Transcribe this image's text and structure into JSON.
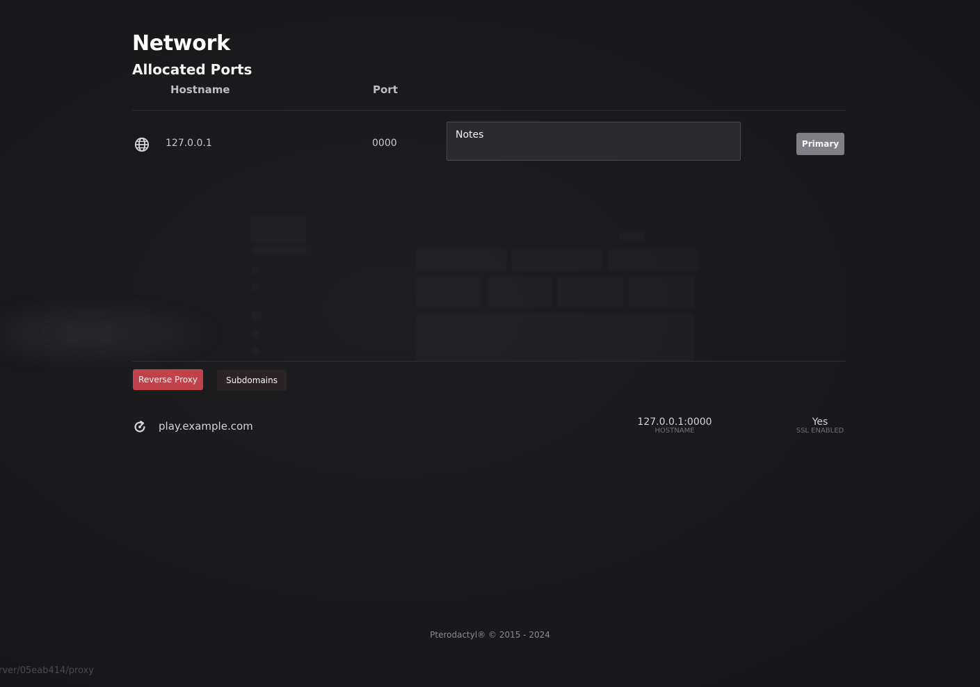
{
  "page": {
    "title": "Network",
    "subtitle": "Allocated Ports"
  },
  "ports_table": {
    "columns": [
      "Hostname",
      "Port"
    ],
    "rows": [
      {
        "icon": "globe-icon",
        "hostname": "127.0.0.1",
        "port": "0000",
        "notes_placeholder": "Notes",
        "primary_label": "Primary"
      }
    ]
  },
  "tabs": {
    "reverse_proxy": "Reverse Proxy",
    "subdomains": "Subdomains",
    "active": "reverse_proxy"
  },
  "proxy": {
    "icon": "refresh-icon",
    "domain": "play.example.com",
    "hostname_value": "127.0.0.1:0000",
    "hostname_label": "HOSTNAME",
    "ssl_value": "Yes",
    "ssl_label": "SSL ENABLED"
  },
  "footer": {
    "text": "Pterodactyl® © 2015 - 2024"
  },
  "status_bar": {
    "url": "rver/05eab414/proxy"
  },
  "colors": {
    "background": "#1a1a1d",
    "accent_red": "#c1424a",
    "primary_badge": "#7f7f86",
    "notes_bg": "#2a2a2f"
  }
}
